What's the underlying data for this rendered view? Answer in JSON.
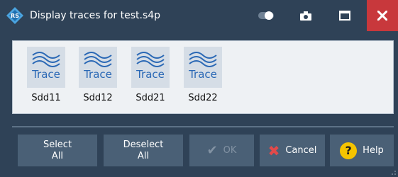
{
  "window": {
    "title": "Display traces for test.s4p",
    "icons": {
      "app": "rs-logo-icon",
      "toggle": "toggle-icon",
      "camera": "camera-icon",
      "maximize": "maximize-icon",
      "close": "close-icon"
    }
  },
  "traces": [
    {
      "icon_text": "Trace",
      "label": "Sdd11"
    },
    {
      "icon_text": "Trace",
      "label": "Sdd12"
    },
    {
      "icon_text": "Trace",
      "label": "Sdd21"
    },
    {
      "icon_text": "Trace",
      "label": "Sdd22"
    }
  ],
  "buttons": {
    "select_all_line1": "Select",
    "select_all_line2": "All",
    "deselect_all_line1": "Deselect",
    "deselect_all_line2": "All",
    "ok": "OK",
    "cancel": "Cancel",
    "help": "Help",
    "help_icon_glyph": "?"
  },
  "colors": {
    "window_bg": "#2f4257",
    "close_bg": "#c8383c",
    "button_bg": "#4a6076",
    "trace_blue": "#2a68b5",
    "cancel_red": "#e24a4a",
    "help_yellow": "#f5c400"
  }
}
